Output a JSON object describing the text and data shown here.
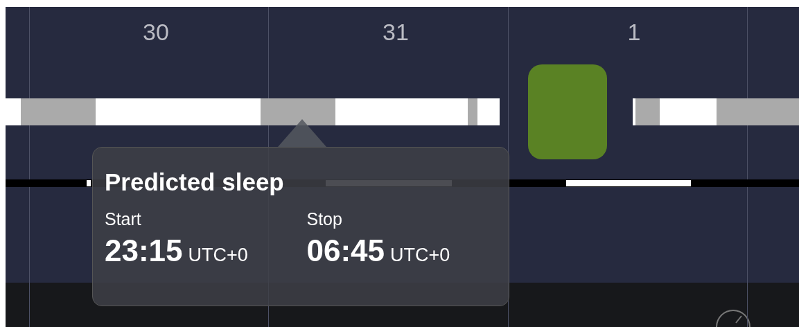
{
  "days": [
    {
      "label": "30"
    },
    {
      "label": "31"
    },
    {
      "label": "1"
    }
  ],
  "tooltip": {
    "title": "Predicted sleep",
    "fields": [
      {
        "label": "Start",
        "time": "23:15",
        "zone": "UTC+0"
      },
      {
        "label": "Stop",
        "time": "06:45",
        "zone": "UTC+0"
      }
    ]
  }
}
